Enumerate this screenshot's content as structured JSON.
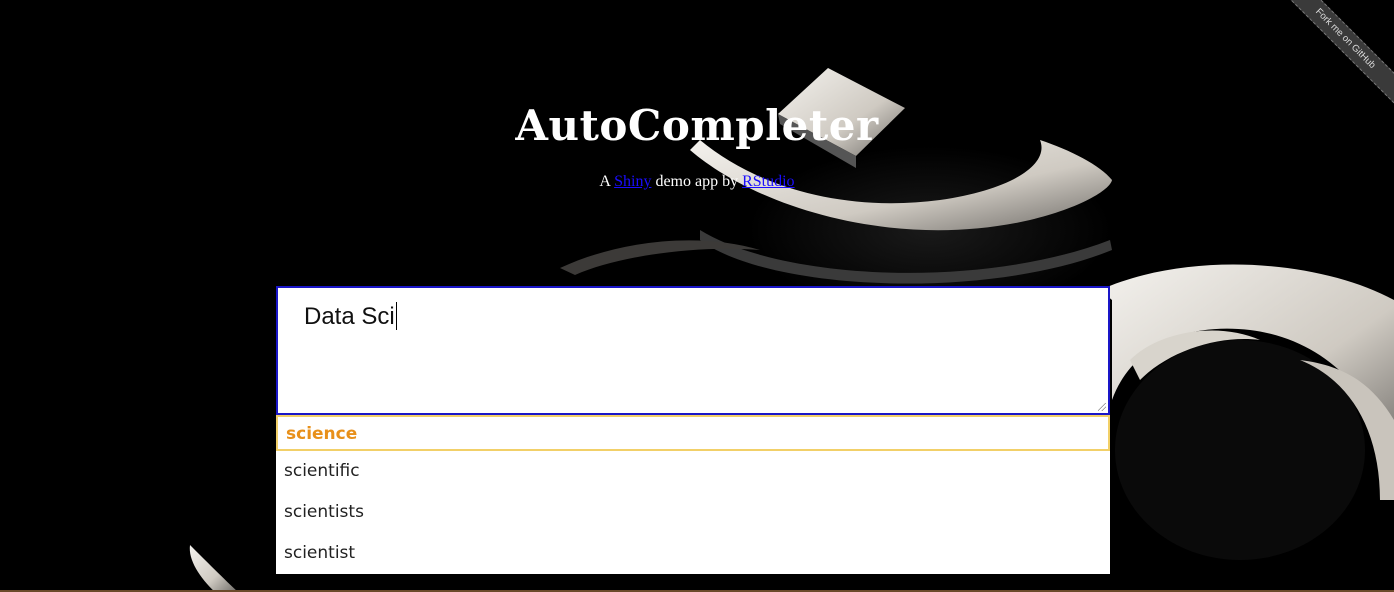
{
  "header": {
    "title": "AutoCompleter",
    "subtitle_prefix": "A",
    "shiny_link": "Shiny",
    "subtitle_middle": "demo app by",
    "rstudio_link": "RStudio"
  },
  "input": {
    "value": "Data Sci"
  },
  "suggestions": [
    "science",
    "scientific",
    "scientists",
    "scientist"
  ],
  "ribbon": {
    "label": "Fork me on GitHub"
  },
  "colors": {
    "input_border": "#1a16c8",
    "active_suggestion_text": "#e8901a",
    "active_suggestion_border": "#f2d068",
    "link": "#1a0dff"
  }
}
